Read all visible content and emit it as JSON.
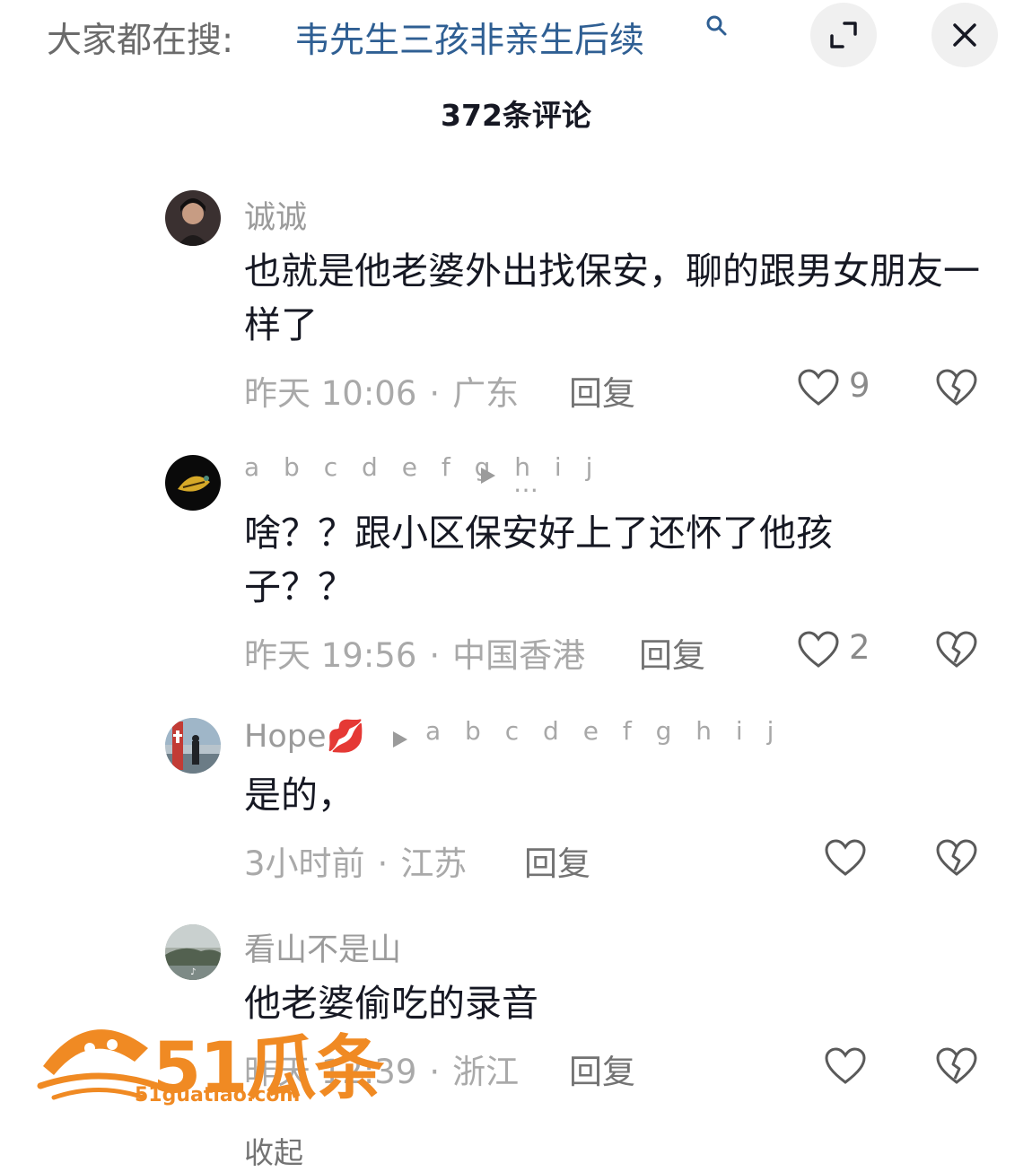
{
  "search": {
    "prefix": "大家都在搜:",
    "term": "韦先生三孩非亲生后续"
  },
  "comments_header": {
    "count_label": "372条评论"
  },
  "comments": [
    {
      "nickname": "诚诚",
      "text": "也就是他老婆外出找保安，聊的跟男女朋友一样了",
      "time": "昨天 10:06",
      "location": "广东",
      "reply_label": "回复",
      "likes": "9"
    },
    {
      "nickname": "a b c d e f g h i j",
      "more": "…",
      "text": "啥？？跟小区保安好上了还怀了他孩子？？",
      "time": "昨天 19:56",
      "location": "中国香港",
      "reply_label": "回复",
      "likes": "2"
    },
    {
      "nickname": "Hope💋",
      "reply_to": "a b c d e f g h i j",
      "text": "是的，",
      "time": "3小时前",
      "location": "江苏",
      "reply_label": "回复",
      "likes": ""
    },
    {
      "nickname": "看山不是山",
      "text": "他老婆偷吃的录音",
      "time": "昨天 12:39",
      "location": "浙江",
      "reply_label": "回复",
      "likes": ""
    }
  ],
  "footer": {
    "collapse_label": "收起"
  },
  "watermark": {
    "brand": "51瓜条",
    "url": "51guatiao.com"
  },
  "colors": {
    "search_term": "#2f5f93",
    "meta_gray": "#a9a9a9",
    "watermark_orange": "#f08a23"
  },
  "icons": [
    "search-icon",
    "expand-icon",
    "close-icon",
    "heart-icon",
    "broken-heart-icon",
    "play-arrow-icon"
  ]
}
